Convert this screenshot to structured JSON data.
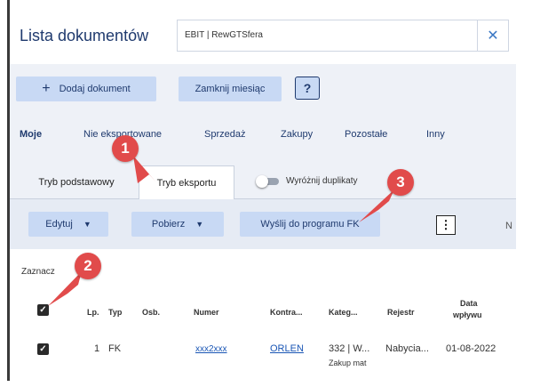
{
  "header": {
    "title": "Lista dokumentów",
    "company_value": "EBIT | RewGTSfera",
    "clear_glyph": "✕"
  },
  "toolbar": {
    "add_label": "Dodaj dokument",
    "add_glyph": "+",
    "close_month_label": "Zamknij miesiąc",
    "help_glyph": "?"
  },
  "categories": {
    "moje": "Moje",
    "nie_eksportowane": "Nie eksportowane",
    "sprzedaz": "Sprzedaż",
    "zakupy": "Zakupy",
    "pozostale": "Pozostałe",
    "inny": "Inny"
  },
  "modes": {
    "basic": "Tryb podstawowy",
    "export": "Tryb eksportu",
    "duplicates_label": "Wyróżnij duplikaty"
  },
  "actions": {
    "edit_label": "Edytuj",
    "download_label": "Pobierz",
    "caret_glyph": "▼",
    "send_label": "Wyślij do programu FK",
    "menu_glyph": "⋮",
    "cut_letter": "N"
  },
  "selection": {
    "label": "Zaznacz"
  },
  "table": {
    "headers": {
      "lp": "Lp.",
      "typ": "Typ",
      "osb": "Osb.",
      "numer": "Numer",
      "kontra": "Kontra...",
      "kateg": "Kateg...",
      "rejestr": "Rejestr",
      "data_1": "Data",
      "data_2": "wpływu"
    },
    "row": {
      "lp": "1",
      "typ": "FK",
      "numer": "xxx2xxx",
      "kontra": "ORLEN",
      "kateg": "332 | W...",
      "kateg_sub": "Zakup mat",
      "rejestr": "Nabycia...",
      "data": "01-08-2022"
    },
    "check_glyph": "✓"
  },
  "callouts": {
    "one": "1",
    "two": "2",
    "three": "3",
    "color": "#e14b4b"
  }
}
